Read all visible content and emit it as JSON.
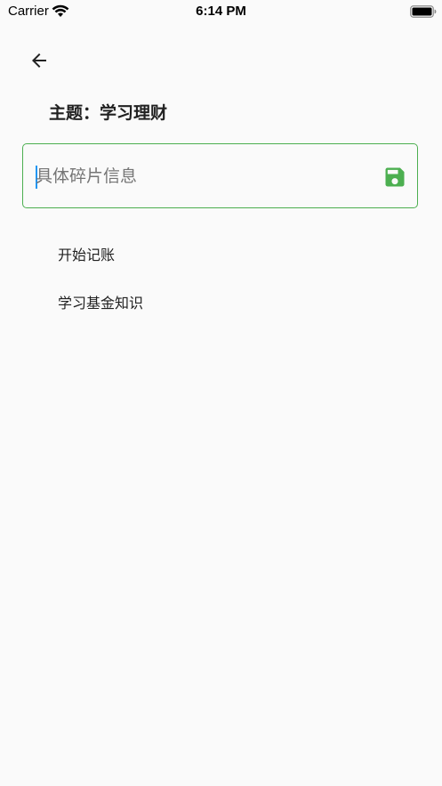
{
  "status_bar": {
    "carrier": "Carrier",
    "time": "6:14 PM",
    "wifi_icon": "wifi-icon",
    "battery_icon": "battery-icon"
  },
  "header": {
    "back_icon": "arrow-left-icon",
    "title": "主题：学习理财"
  },
  "input": {
    "value": "",
    "placeholder": "具体碎片信息",
    "border_color": "#4caf50",
    "caret_color": "#2196f3"
  },
  "save_button": {
    "icon": "floppy-disk-icon",
    "color": "#4caf50"
  },
  "fragments": [
    {
      "label": "开始记账"
    },
    {
      "label": "学习基金知识"
    }
  ],
  "colors": {
    "background": "#fafafa",
    "text": "#212121",
    "accent": "#4caf50"
  }
}
